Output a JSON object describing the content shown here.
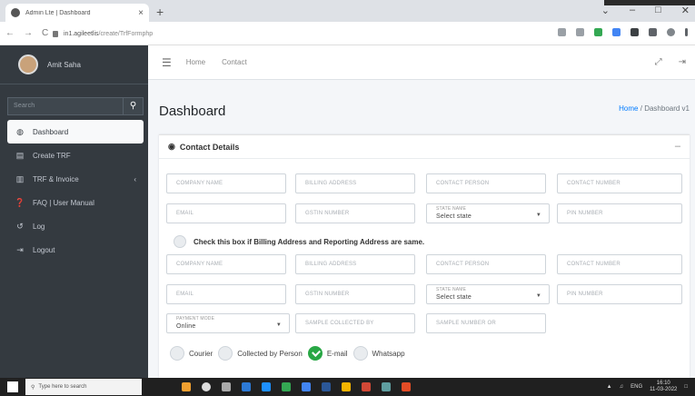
{
  "browser": {
    "tab_title": "Admin Lte | Dashboard",
    "tab_close": "×",
    "new_tab": "+",
    "url_host": "in1.agileetlis",
    "url_path": "/create/TrfFormphp",
    "window_controls": [
      "⌄",
      "–",
      "□",
      "✕"
    ]
  },
  "sidebar": {
    "user_name": "Amit Saha",
    "search_placeholder": "Search",
    "items": [
      {
        "label": "Dashboard",
        "icon": "dashboard-icon",
        "glyph": "◍",
        "active": true
      },
      {
        "label": "Create TRF",
        "icon": "document-icon",
        "glyph": "▤"
      },
      {
        "label": "TRF & Invoice",
        "icon": "copy-icon",
        "glyph": "▥",
        "caret": "‹"
      },
      {
        "label": "FAQ | User Manual",
        "icon": "question-icon",
        "glyph": "❓"
      },
      {
        "label": "Log",
        "icon": "history-icon",
        "glyph": "↺"
      },
      {
        "label": "Logout",
        "icon": "logout-icon",
        "glyph": "⇥"
      }
    ]
  },
  "topnav": {
    "home": "Home",
    "contact": "Contact"
  },
  "page": {
    "title": "Dashboard",
    "breadcrumb_home": "Home",
    "breadcrumb_sep": "/",
    "breadcrumb_current": "Dashboard v1"
  },
  "card": {
    "title": "Contact Details",
    "collapse": "–",
    "billing_fields": {
      "company_name": "COMPANY NAME",
      "billing_address": "BILLING ADDRESS",
      "contact_person": "CONTACT PERSON",
      "contact_number": "CONTACT NUMBER",
      "email": "EMAIL",
      "gstin_number": "GSTIN NUMBER",
      "state_label": "STATE NAME",
      "state_value": "Select state",
      "pin_number": "PIN NUMBER"
    },
    "same_address_label": "Check this box if Billing Address and Reporting Address are same.",
    "reporting_fields": {
      "company_name": "COMPANY NAME",
      "billing_address": "BILLING ADDRESS",
      "contact_person": "CONTACT PERSON",
      "contact_number": "CONTACT NUMBER",
      "email": "EMAIL",
      "gstin_number": "GSTIN NUMBER",
      "state_label": "STATE NAME",
      "state_value": "Select state",
      "pin_number": "PIN NUMBER"
    },
    "payment_mode_label": "PAYMENT MODE",
    "payment_mode_value": "Online",
    "sample_collected_by": "SAMPLE COLLECTED BY",
    "sample_number": "SAMPLE NUMBER OR",
    "delivery_options": [
      {
        "label": "Courier",
        "checked": false
      },
      {
        "label": "Collected by Person",
        "checked": false
      },
      {
        "label": "E-mail",
        "checked": true
      },
      {
        "label": "Whatsapp",
        "checked": false
      }
    ]
  },
  "taskbar": {
    "search_placeholder": "Type here to search",
    "tray_text": "ENG",
    "time": "16:10",
    "date": "11-03-2022"
  }
}
